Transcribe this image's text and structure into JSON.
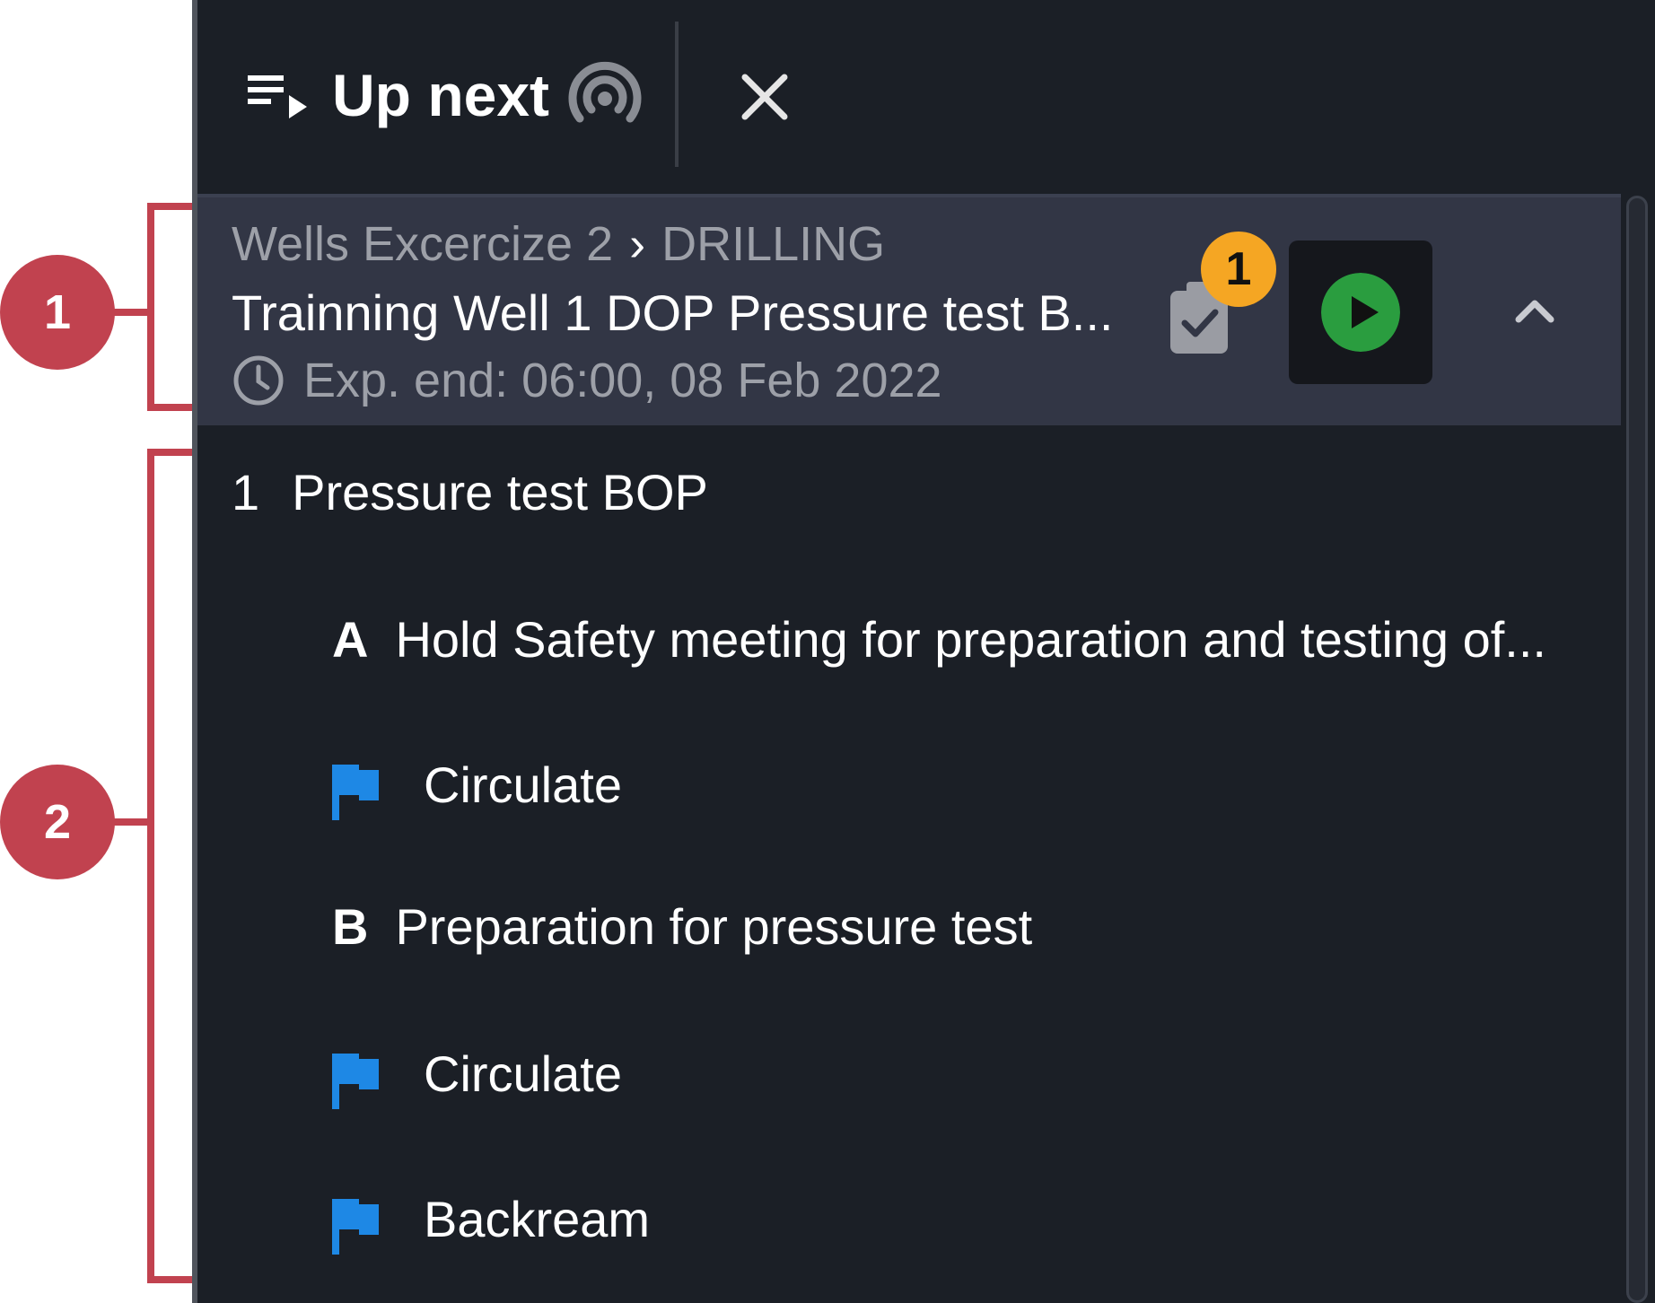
{
  "header": {
    "title": "Up next",
    "icons": [
      "queue-play-icon",
      "broadcast-icon",
      "close-icon"
    ]
  },
  "active_card": {
    "breadcrumb": {
      "parent": "Wells Excercize 2",
      "separator": "›",
      "child": "DRILLING"
    },
    "title": "Trainning Well 1 DOP Pressure test B...",
    "expected_end": "Exp. end: 06:00, 08 Feb 2022",
    "checklist_badge_count": "1",
    "icons": [
      "clock-icon",
      "checklist-icon",
      "play-icon",
      "chevron-up-icon"
    ]
  },
  "steps": [
    {
      "number": "1",
      "label": "Pressure test BOP"
    }
  ],
  "substeps": [
    {
      "letter": "A",
      "label": "Hold Safety meeting for preparation and testing of..."
    },
    {
      "letter": "B",
      "label": "Preparation for pressure test"
    }
  ],
  "flag_items": [
    {
      "label": "Circulate",
      "icon": "flag-icon"
    },
    {
      "label": "Circulate",
      "icon": "flag-icon"
    },
    {
      "label": "Backream",
      "icon": "flag-icon"
    }
  ],
  "annotations": {
    "callout_1": "1",
    "callout_2": "2"
  },
  "colors": {
    "panel_bg": "#1b1f26",
    "card_bg": "#323645",
    "badge": "#f5a623",
    "play_green": "#2a9d3f",
    "flag_blue": "#1e88e5",
    "annotation_red": "#c1424f"
  }
}
